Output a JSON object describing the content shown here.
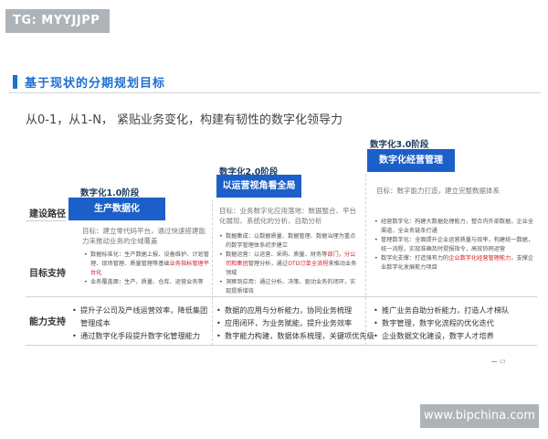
{
  "watermark_top": "TG: MYYJJPP",
  "watermark_bottom": "www.bipchina.com",
  "heading": "基于现状的分期规划目标",
  "subtitle": "从0-1，从1-N， 紧贴业务变化，构建有韧性的数字化领导力",
  "rows": {
    "path": "建设路径",
    "goals": "目标支持",
    "capability": "能力支持"
  },
  "phases": [
    {
      "label": "数字化1.0阶段",
      "box": "生产数据化",
      "desc": "目标：建立零代码平台，通过快速搭建能力来推动业务的全域覆盖",
      "goals": [
        {
          "pre": "数据标准化：生产数据上报、设备维护、计划管理、现场管理、质量管理等基础",
          "red": "业务指标管理平台化",
          "post": ""
        },
        {
          "pre": "业务覆盖面：生产、质量、仓库、运营业务等",
          "red": "",
          "post": ""
        }
      ],
      "capability": [
        "提升子公司及产线运营效率，降低集团管理成本",
        "通过数字化手段提升数字化管理能力"
      ]
    },
    {
      "label": "数字化2.0阶段",
      "box": "以运营视角看全局",
      "desc": "目标：业务数字化应用落地：数据整合、平台化展现、系统化的分析、自助分析",
      "goals": [
        {
          "pre": "数据集成：以数据质量、数据管理、数据治理为重点的数字管理体系初步建立",
          "red": "",
          "post": ""
        },
        {
          "pre": "数据运营：以运营、采购、质量、财务等",
          "red": "部门，分公司和集团",
          "post": "管理分析，通过"
        },
        {
          "pre": "",
          "red": "OTD订单全流程",
          "post": "来推动业务领域"
        },
        {
          "pre": "洞察到应用：通过分析、决策、驱动业务的闭环，实现提质增效",
          "red": "",
          "post": ""
        }
      ],
      "capability": [
        "数据的应用与分析能力，协同业务梳理",
        "应用闭环，为业务赋能，提升业务效率",
        "数字能力构建，数据体系梳理，关键项优先级"
      ]
    },
    {
      "label": "数字化3.0阶段",
      "box": "数字化经营管理",
      "desc": "目标：数字能力打造，建立完整数据体系",
      "goals": [
        {
          "pre": "经营数字化：构建大数据处理能力，整合内外部数据，企业全渠道，全业务链条打通",
          "red": "",
          "post": ""
        },
        {
          "pre": "管理数字化：全面提升企业运营质量与效率，构建统一数据，统一流程，实现准确及时提报指令，高效协同运营",
          "red": "",
          "post": ""
        },
        {
          "pre": "数字化支撑：打造强有力的",
          "red": "企业数字化经营管理能力",
          "post": "，支撑企业数字化发展能力项目"
        }
      ],
      "capability": [
        "推广业务自助分析能力，打造人才梯队",
        "数字管理，数字化流程的优化迭代",
        "企业数据文化建设，数字人才培养"
      ]
    }
  ],
  "footer": "13",
  "colors": {
    "accent": "#1d6fd1",
    "box": "#1d5fc8",
    "highlight": "#d2232a"
  }
}
